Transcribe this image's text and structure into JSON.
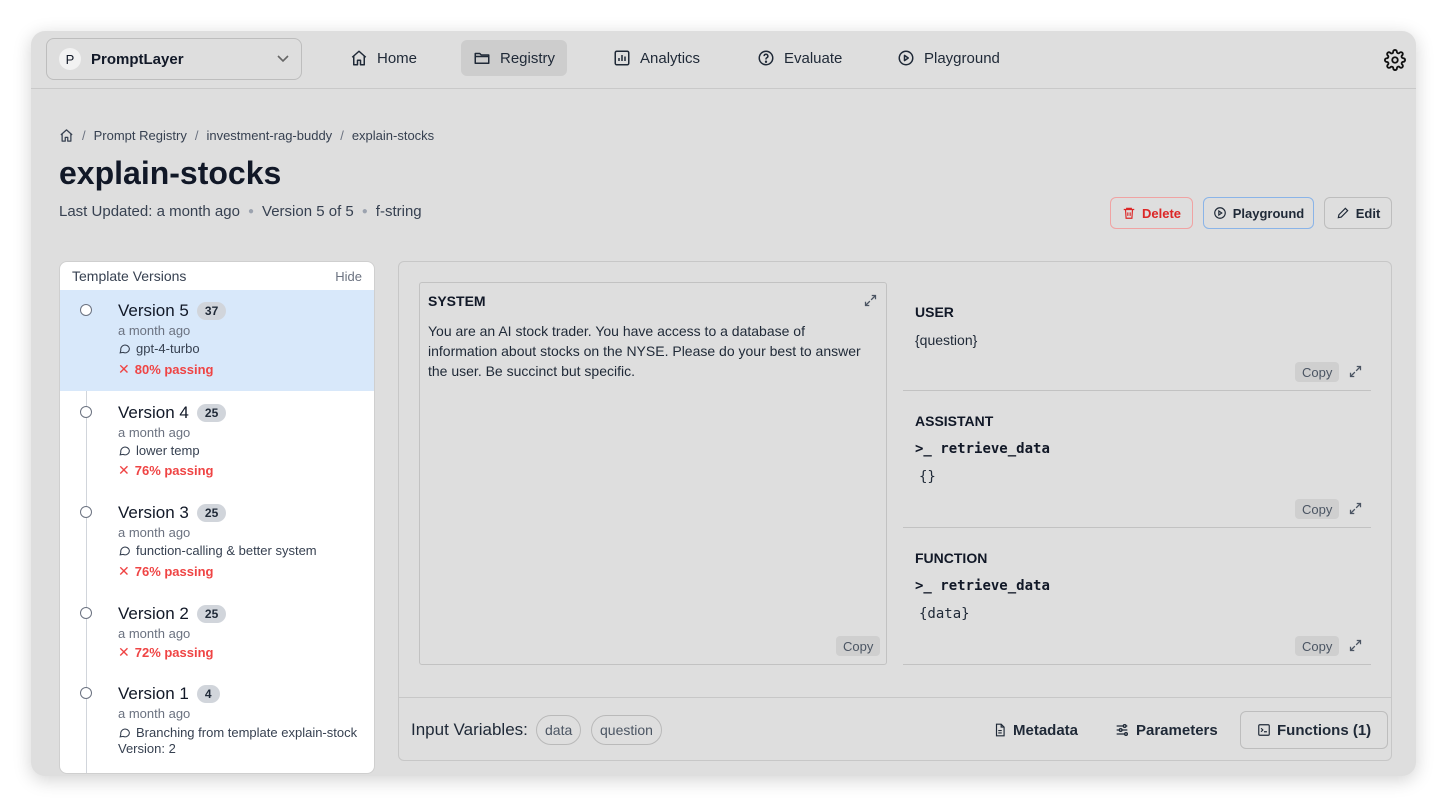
{
  "workspace": {
    "badge": "P",
    "name": "PromptLayer"
  },
  "nav": [
    {
      "label": "Home",
      "icon": "home-icon"
    },
    {
      "label": "Registry",
      "icon": "folder-icon"
    },
    {
      "label": "Analytics",
      "icon": "bar-chart-icon"
    },
    {
      "label": "Evaluate",
      "icon": "help-circle-icon"
    },
    {
      "label": "Playground",
      "icon": "play-circle-icon"
    }
  ],
  "breadcrumb": [
    "Prompt Registry",
    "investment-rag-buddy",
    "explain-stocks"
  ],
  "page": {
    "title": "explain-stocks",
    "last_updated": "Last Updated: a month ago",
    "version_info": "Version 5 of 5",
    "format": "f-string"
  },
  "actions": {
    "delete": "Delete",
    "playground": "Playground",
    "edit": "Edit"
  },
  "versions_panel": {
    "title": "Template Versions",
    "hide": "Hide",
    "versions": [
      {
        "label": "Version 5",
        "count": "37",
        "time": "a month ago",
        "message": "gpt-4-turbo",
        "passing": "80% passing"
      },
      {
        "label": "Version 4",
        "count": "25",
        "time": "a month ago",
        "message": "lower temp",
        "passing": "76% passing"
      },
      {
        "label": "Version 3",
        "count": "25",
        "time": "a month ago",
        "message": "function-calling & better system",
        "passing": "76% passing"
      },
      {
        "label": "Version 2",
        "count": "25",
        "time": "a month ago",
        "message": "",
        "passing": "72% passing"
      },
      {
        "label": "Version 1",
        "count": "4",
        "time": "a month ago",
        "message": "Branching from template explain-stock",
        "message2": "Version: 2",
        "passing": ""
      }
    ]
  },
  "messages": {
    "system": {
      "role": "SYSTEM",
      "content": "You are an AI stock trader. You have access to a database of information about stocks on the NYSE. Please do your best to answer the user. Be succinct but specific."
    },
    "user": {
      "role": "USER",
      "content": "{question}"
    },
    "assistant": {
      "role": "ASSISTANT",
      "function": "retrieve_data",
      "args": "{}"
    },
    "function": {
      "role": "FUNCTION",
      "function": "retrieve_data",
      "args": "{data}"
    },
    "copy_label": "Copy",
    "fn_prefix": ">_"
  },
  "footer": {
    "input_variables_label": "Input Variables:",
    "variables": [
      "data",
      "question"
    ],
    "metadata": "Metadata",
    "parameters": "Parameters",
    "functions": "Functions (1)"
  }
}
